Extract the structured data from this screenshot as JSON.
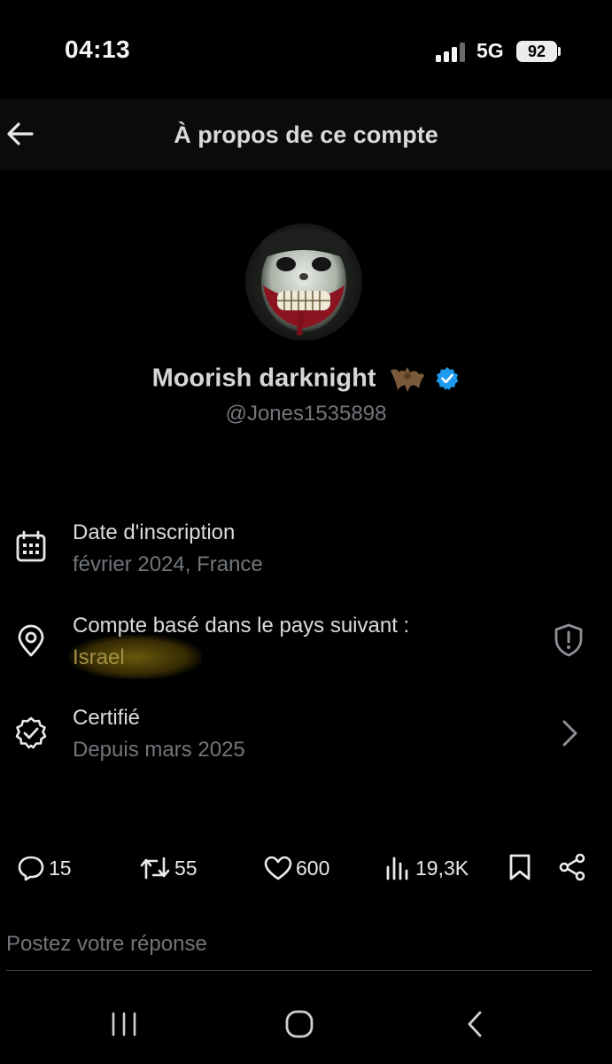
{
  "status_bar": {
    "time": "04:13",
    "network": "5G",
    "battery": "92"
  },
  "header": {
    "title": "À propos de ce compte",
    "back_icon": "arrow-left-icon"
  },
  "profile": {
    "name": "Moorish darknight",
    "name_emoji_icon": "bat-icon",
    "verified_icon": "verified-badge-icon",
    "handle": "@Jones1535898"
  },
  "info": [
    {
      "icon": "calendar-icon",
      "label": "Date d'inscription",
      "value": "février 2024, France"
    },
    {
      "icon": "location-pin-icon",
      "label": "Compte basé dans le pays suivant :",
      "value": "Israel",
      "trailing_icon": "shield-alert-icon"
    },
    {
      "icon": "verified-outline-icon",
      "label": "Certifié",
      "value": "Depuis mars 2025",
      "trailing_icon": "chevron-right-icon"
    }
  ],
  "actions": {
    "replies": "15",
    "reposts": "55",
    "likes": "600",
    "views": "19,3K"
  },
  "reply_box": {
    "placeholder": "Postez votre réponse"
  },
  "colors": {
    "background": "#000000",
    "text": "#e7e9ea",
    "muted": "#71767b",
    "verified": "#1d9bf0",
    "highlight": "#a38f43"
  }
}
